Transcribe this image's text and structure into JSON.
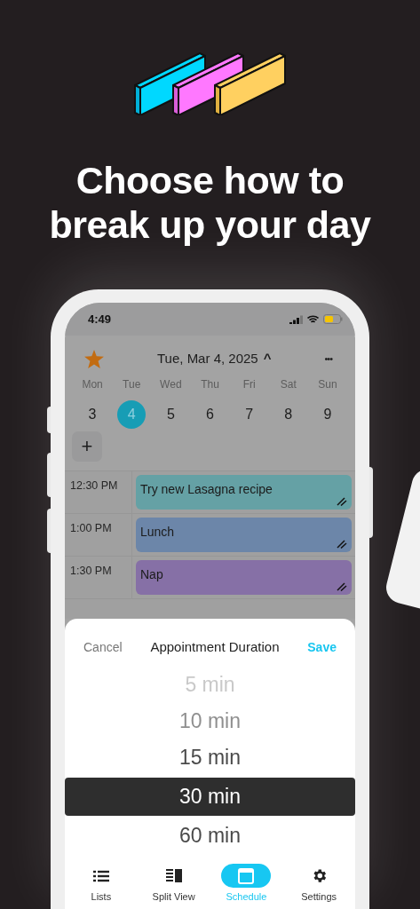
{
  "headline": [
    "Choose how to",
    "break up your day"
  ],
  "status_bar": {
    "time": "4:49"
  },
  "calendar": {
    "title": "Tue, Mar 4, 2025",
    "caret": "^",
    "more": "•••",
    "add": "+",
    "days": [
      {
        "weekday": "Mon",
        "date": "3",
        "selected": false
      },
      {
        "weekday": "Tue",
        "date": "4",
        "selected": true
      },
      {
        "weekday": "Wed",
        "date": "5",
        "selected": false
      },
      {
        "weekday": "Thu",
        "date": "6",
        "selected": false
      },
      {
        "weekday": "Fri",
        "date": "7",
        "selected": false
      },
      {
        "weekday": "Sat",
        "date": "8",
        "selected": false
      },
      {
        "weekday": "Sun",
        "date": "9",
        "selected": false
      }
    ]
  },
  "schedule": [
    {
      "time": "12:30 PM",
      "title": "Try new Lasagna recipe",
      "color": "#65a1a5"
    },
    {
      "time": "1:00 PM",
      "title": "Lunch",
      "color": "#6c86a9"
    },
    {
      "time": "1:30 PM",
      "title": "Nap",
      "color": "#8670a6"
    }
  ],
  "sheet": {
    "cancel": "Cancel",
    "title": "Appointment Duration",
    "save": "Save",
    "options": [
      {
        "label": "5 min",
        "selected": false
      },
      {
        "label": "10 min",
        "selected": false
      },
      {
        "label": "15 min",
        "selected": false
      },
      {
        "label": "30 min",
        "selected": true
      },
      {
        "label": "60 min",
        "selected": false
      }
    ]
  },
  "tabs": [
    {
      "kind": "list",
      "label": "Lists",
      "selected": false
    },
    {
      "kind": "split",
      "label": "Split View",
      "selected": false
    },
    {
      "kind": "calendar",
      "label": "Schedule",
      "selected": true
    },
    {
      "kind": "gear",
      "label": "Settings",
      "selected": false
    }
  ]
}
